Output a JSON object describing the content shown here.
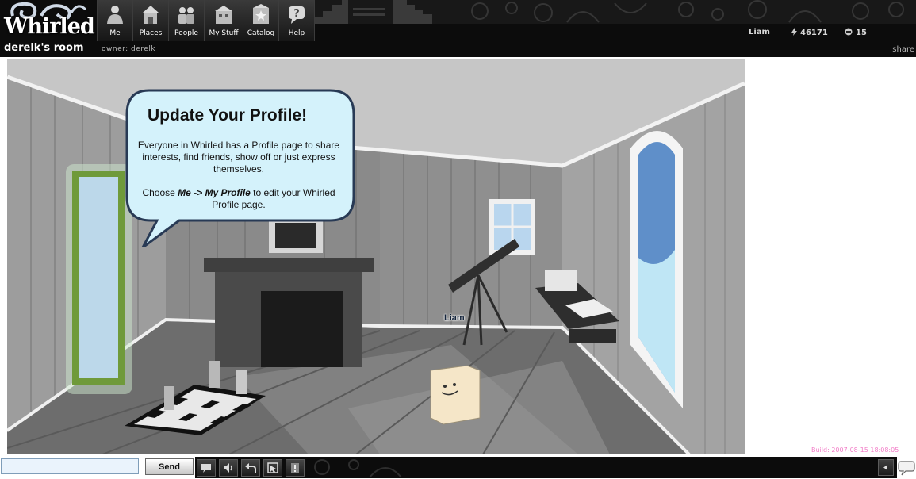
{
  "app": {
    "logo_text": "Whirled"
  },
  "nav": {
    "items": [
      {
        "id": "me",
        "label": "Me",
        "icon": "me-icon"
      },
      {
        "id": "places",
        "label": "Places",
        "icon": "places-icon"
      },
      {
        "id": "people",
        "label": "People",
        "icon": "people-icon"
      },
      {
        "id": "mystuff",
        "label": "My Stuff",
        "icon": "my-stuff-icon"
      },
      {
        "id": "catalog",
        "label": "Catalog",
        "icon": "catalog-icon"
      },
      {
        "id": "help",
        "label": "Help",
        "icon": "help-icon"
      }
    ]
  },
  "room": {
    "name": "derelk's room",
    "owner": "owner: derelk"
  },
  "user": {
    "name": "Liam",
    "coins": "46171",
    "level": "15"
  },
  "header": {
    "share_label": "share"
  },
  "bubble": {
    "title": "Update Your Profile!",
    "line1": "Everyone in Whirled has a Profile page to share interests, find friends, show off or just express themselves.",
    "line2_prefix": "Choose ",
    "line2_emph": "Me -> My Profile",
    "line2_suffix": " to edit your Whirled Profile page."
  },
  "avatar": {
    "name": "Liam"
  },
  "build": {
    "text": "Build: 2007-08-15 18:08:05"
  },
  "chat": {
    "input_value": "",
    "send_label": "Send"
  },
  "controls": {
    "items": [
      {
        "name": "chat-history-icon"
      },
      {
        "name": "volume-icon"
      },
      {
        "name": "back-arrow-icon"
      },
      {
        "name": "edit-room-icon"
      },
      {
        "name": "alert-icon"
      }
    ]
  },
  "colors": {
    "header_bg": "#0c0c0c",
    "bubble_fill": "#d4f2fb",
    "bubble_stroke": "#283a55",
    "build_text": "#f27cc7"
  }
}
